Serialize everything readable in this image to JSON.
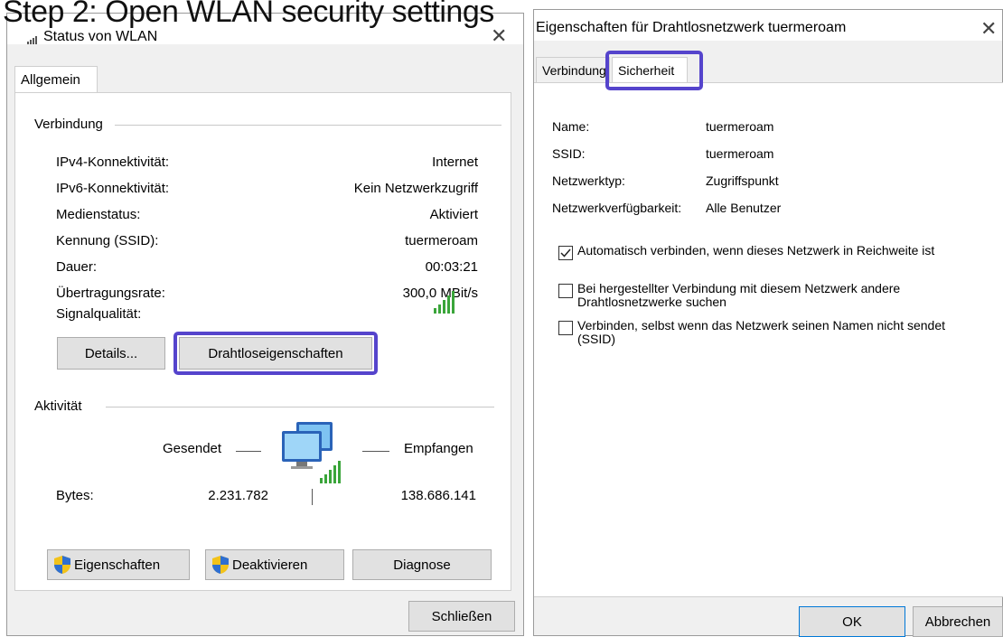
{
  "caption": "Step 2: Open WLAN security settings",
  "status_window": {
    "title": "Status von WLAN",
    "tab": "Allgemein",
    "connection_group": "Verbindung",
    "rows": [
      {
        "label": "IPv4-Konnektivität:",
        "value": "Internet"
      },
      {
        "label": "IPv6-Konnektivität:",
        "value": "Kein Netzwerkzugriff"
      },
      {
        "label": "Medienstatus:",
        "value": "Aktiviert"
      },
      {
        "label": "Kennung (SSID):",
        "value": "tuermeroam"
      },
      {
        "label": "Dauer:",
        "value": "00:03:21"
      },
      {
        "label": "Übertragungsrate:",
        "value": "300,0 MBit/s"
      }
    ],
    "signal_label": "Signalqualität:",
    "details_button": "Details...",
    "wireless_props_button": "Drahtloseigenschaften",
    "activity_group": "Aktivität",
    "sent_label": "Gesendet",
    "received_label": "Empfangen",
    "bytes_label": "Bytes:",
    "bytes_sent": "2.231.782",
    "bytes_received": "138.686.141",
    "properties_button": "Eigenschaften",
    "deactivate_button": "Deaktivieren",
    "diagnose_button": "Diagnose",
    "close_button": "Schließen"
  },
  "properties_window": {
    "title": "Eigenschaften für Drahtlosnetzwerk tuermeroam",
    "tab_connection": "Verbindung",
    "tab_security": "Sicherheit",
    "fields": [
      {
        "label": "Name:",
        "value": "tuermeroam"
      },
      {
        "label": "SSID:",
        "value": "tuermeroam"
      },
      {
        "label": "Netzwerktyp:",
        "value": "Zugriffspunkt"
      },
      {
        "label": "Netzwerkverfügbarkeit:",
        "value": "Alle Benutzer"
      }
    ],
    "options": [
      {
        "label": "Automatisch verbinden, wenn dieses Netzwerk in Reichweite ist",
        "checked": true
      },
      {
        "label": "Bei hergestellter Verbindung mit diesem Netzwerk andere Drahtlosnetzwerke suchen",
        "checked": false
      },
      {
        "label": "Verbinden, selbst wenn das Netzwerk seinen Namen nicht sendet (SSID)",
        "checked": false
      }
    ],
    "ok_button": "OK",
    "cancel_button": "Abbrechen"
  },
  "colors": {
    "highlight": "#5544cc",
    "signal_green": "#3aa53a"
  }
}
